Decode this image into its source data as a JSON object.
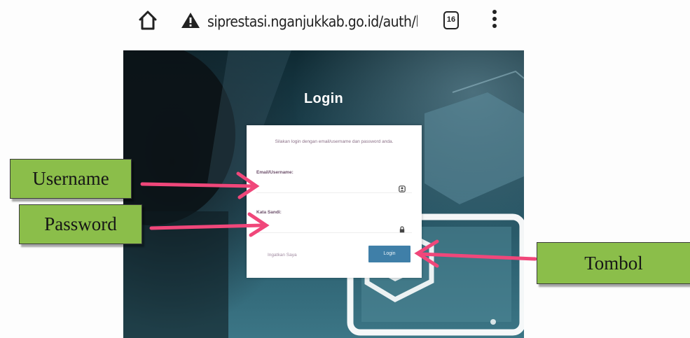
{
  "browser": {
    "url": "siprestasi.nganjukkab.go.id/auth/log",
    "tab_count": "16",
    "icons": [
      "home-icon",
      "warning-icon",
      "tabs-icon",
      "more-vert-icon"
    ]
  },
  "page": {
    "title": "Login",
    "card": {
      "intro": "Silakan login dengan email/username dan password anda.",
      "email_label": "Email/Username:",
      "password_label": "Kata Sandi:",
      "remember_label": "Ingatkan Saya",
      "login_button": "Login",
      "icons": [
        "user-icon",
        "lock-icon"
      ]
    }
  },
  "annotations": {
    "username": "Username",
    "password": "Password",
    "tombol": "Tombol",
    "arrow_color": "#f0477a",
    "callout_color": "#8bbe4a"
  }
}
